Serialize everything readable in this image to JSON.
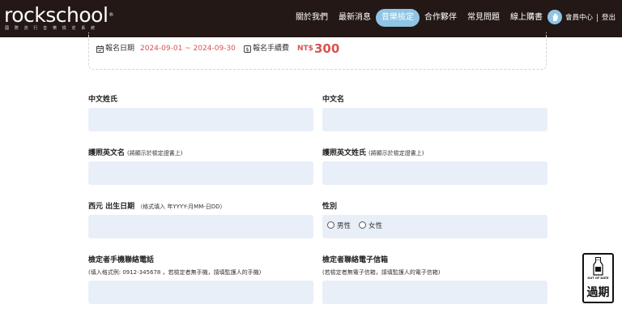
{
  "header": {
    "logo": "rockschool",
    "logo_reg": "®",
    "logo_subtitle": "國 際 流 行 音 樂 檢 定 系 統",
    "nav": [
      "關於我們",
      "最新消息",
      "音樂檢定",
      "合作夥伴",
      "常見問題",
      "線上購書"
    ],
    "active_nav": "音樂檢定",
    "member_label": "會員中心",
    "separator": "|",
    "logout_label": "登出"
  },
  "info": {
    "date_label": "報名日期",
    "date_range": "2024-09-01 ~ 2024-09-30",
    "fee_label": "報名手續費",
    "fee_currency": "NT$",
    "fee_amount": "300"
  },
  "form": {
    "chinese_surname": {
      "label": "中文姓氏",
      "value": ""
    },
    "chinese_name": {
      "label": "中文名",
      "value": ""
    },
    "passport_given_name": {
      "label": "護照英文名",
      "note": "(將顯示於檢定證書上)",
      "value": ""
    },
    "passport_surname": {
      "label": "護照英文姓氏",
      "note": "(將顯示於檢定證書上)",
      "value": ""
    },
    "birthdate": {
      "label": "西元 出生日期",
      "note": "（格式填入 年YYYY-月MM-日DD）",
      "value": ""
    },
    "gender": {
      "label": "性別",
      "options": [
        "男性",
        "女性"
      ],
      "selected": ""
    },
    "phone": {
      "label": "檢定者手機聯絡電話",
      "note": "(填入格式例: 0912-345678 ，若檢定者無手機，請填監護人的手機)",
      "value": ""
    },
    "email": {
      "label": "檢定者聯絡電子信箱",
      "note": "(若檢定者無電子信箱，請填監護人的電子信箱)",
      "value": ""
    }
  },
  "badge": {
    "small_text": "OUT OF DATE",
    "big_text": "過期"
  },
  "colors": {
    "header_bg": "#231815",
    "accent": "#8fc4e4",
    "price": "#d9534f",
    "input_bg": "#e9eff9"
  },
  "icons": [
    "calendar-icon",
    "fee-icon",
    "user-hand-icon",
    "milk-bottle-icon"
  ]
}
